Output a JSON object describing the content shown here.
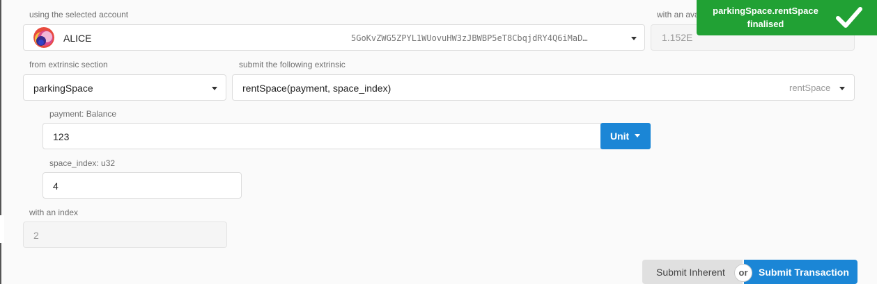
{
  "account": {
    "label": "using the selected account",
    "name": "ALICE",
    "address": "5GoKvZWG5ZPYL1WUovuHW3zJBWBP5eT8CbqjdRY4Q6iMaD…"
  },
  "balance": {
    "label": "with an ava",
    "value": "1.152E"
  },
  "extrinsic": {
    "section_label": "from extrinsic section",
    "section_value": "parkingSpace",
    "method_label": "submit the following extrinsic",
    "method_value": "rentSpace(payment, space_index)",
    "method_short": "rentSpace"
  },
  "params": {
    "payment_label": "payment: Balance",
    "payment_value": "123",
    "unit_label": "Unit",
    "space_index_label": "space_index: u32",
    "space_index_value": "4"
  },
  "index": {
    "label": "with an index",
    "value": "2"
  },
  "actions": {
    "inherent_label": "Submit Inherent",
    "or_label": "or",
    "transaction_label": "Submit Transaction"
  },
  "toast": {
    "title": "parkingSpace.rentSpace",
    "status": "finalised",
    "icon": "checkmark-icon",
    "color": "#21a134"
  },
  "colors": {
    "primary": "#1b86d6"
  }
}
